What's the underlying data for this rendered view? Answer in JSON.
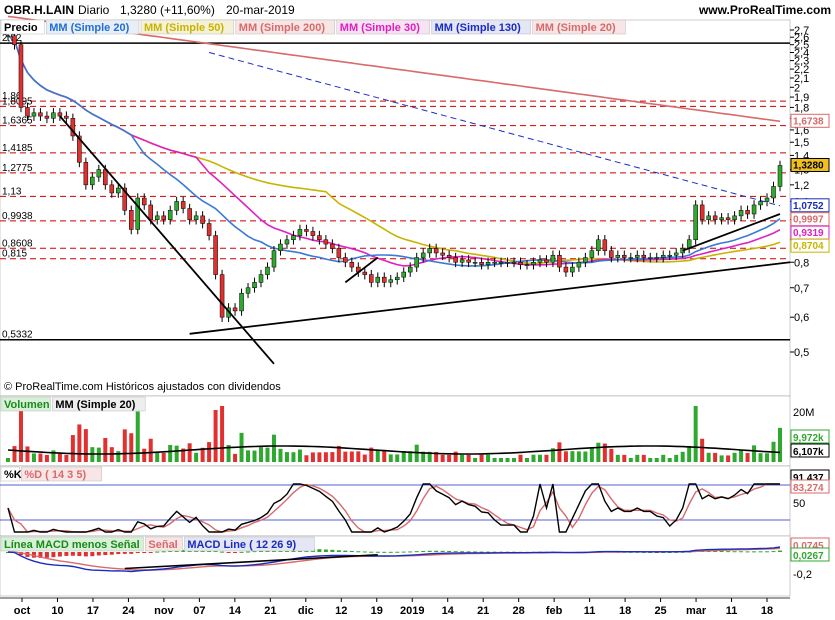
{
  "header": {
    "symbol": "OBR.H.LAIN",
    "period": "Diario",
    "last": "1,3280 (+11,60%)",
    "date": "20-mar-2019",
    "site": "www.ProRealTime.com"
  },
  "legends": {
    "price": [
      {
        "text": "Precio",
        "color": "#000000",
        "bg": "#ffffff"
      },
      {
        "text": "MM (Simple 20)",
        "color": "#1f6fd6",
        "bg": "#e8eef8"
      },
      {
        "text": "MM (Simple 50)",
        "color": "#c8b400",
        "bg": "#f5f1d8"
      },
      {
        "text": "MM (Simple 200)",
        "color": "#d86a6a",
        "bg": "#f8e6e6"
      },
      {
        "text": "MM (Simple 30)",
        "color": "#e020c0",
        "bg": "#f7e4f3"
      },
      {
        "text": "MM (Simple 130)",
        "color": "#1a2cc0",
        "bg": "#e4e6f6"
      },
      {
        "text": "MM (Simple 20)",
        "color": "#d86a6a",
        "bg": "#f8e6e6"
      }
    ],
    "volume": [
      {
        "text": "Volumen",
        "color": "#1a8a1a",
        "bg": "#d8f0d8"
      },
      {
        "text": "MM (Simple 20)",
        "color": "#000000",
        "bg": "#eeeeee"
      }
    ],
    "stoch": [
      {
        "text": "%K",
        "color": "#000000",
        "bg": "#ffffff"
      },
      {
        "text": "%D ( 14 3 5)",
        "color": "#d86a6a",
        "bg": "#f8e6e6"
      }
    ],
    "macd": [
      {
        "text": "Línea MACD menos Señal",
        "color": "#1a8a1a",
        "bg": "#d8f0d8"
      },
      {
        "text": "Señal",
        "color": "#d86a6a",
        "bg": "#f8e6e6"
      },
      {
        "text": "MACD Line ( 12 26 9)",
        "color": "#1a2cc0",
        "bg": "#e4e6f6"
      }
    ]
  },
  "footer_note": "© ProRealTime.com Históricos ajustados con dividendos",
  "price_axis_ticks": [
    "2,7",
    "2,6",
    "2,5",
    "2,4",
    "2,3",
    "2,2",
    "2,1",
    "2",
    "1,9",
    "1,8",
    "1,7",
    "1,6",
    "1,5",
    "1,4",
    "1,3",
    "1,2",
    "1,1",
    "1",
    "0,9",
    "0,8",
    "0,7",
    "0,6",
    "0,5"
  ],
  "hline_labels": [
    "2,52",
    "1,86",
    "1,8095",
    "1,6365",
    "1,4185",
    "1,2775",
    "1,13",
    "0,9938",
    "0,8608",
    "0,815",
    "0,5332"
  ],
  "price_tags": [
    {
      "text": "1,6738",
      "value": 1.6738,
      "color": "#d86a6a",
      "bg": "#ffffff"
    },
    {
      "text": "1,3280",
      "value": 1.328,
      "color": "#000000",
      "bg": "#f0c020"
    },
    {
      "text": "1,0752",
      "value": 1.0752,
      "color": "#1a2cc0",
      "bg": "#ffffff"
    },
    {
      "text": "0,9997",
      "value": 0.9997,
      "color": "#d86a6a",
      "bg": "#ffffff"
    },
    {
      "text": "0,9319",
      "value": 0.9319,
      "color": "#e020c0",
      "bg": "#ffffff"
    },
    {
      "text": "0,8704",
      "value": 0.8704,
      "color": "#c8b400",
      "bg": "#ffffff"
    }
  ],
  "volume_axis": {
    "top": "20M",
    "val1": "9,972k",
    "val2": "6,107k"
  },
  "stoch_axis": {
    "tick": "50",
    "val1": "91,437",
    "val2": "83,274"
  },
  "macd_axis": {
    "tick1": "0",
    "tick2": "-0,2",
    "val1": "0,0745",
    "val2": "0,0267"
  },
  "date_labels": [
    "oct",
    "10",
    "17",
    "24",
    "nov",
    "07",
    "14",
    "21",
    "dic",
    "12",
    "19",
    "2019",
    "14",
    "21",
    "28",
    "feb",
    "11",
    "18",
    "25",
    "mar",
    "11",
    "18"
  ],
  "colors": {
    "up": "#2fa82f",
    "down": "#e03030",
    "ma20": "#3a7ad6",
    "ma50": "#c8b400",
    "ma200": "#d86a6a",
    "ma30": "#e020c0",
    "ma130": "#1a2cc0",
    "hline": "#cc0000"
  },
  "chart_data": {
    "type": "candlestick",
    "title": "OBR.H.LAIN Diario",
    "ylim": [
      0.5,
      2.7
    ],
    "log_scale": true,
    "horizontal_levels": [
      2.52,
      1.86,
      1.8095,
      1.6365,
      1.4185,
      1.2775,
      1.13,
      0.9938,
      0.8608,
      0.815,
      0.5332
    ],
    "close_series": [
      2.62,
      2.5,
      1.8,
      1.72,
      1.75,
      1.72,
      1.7,
      1.75,
      1.72,
      1.7,
      1.55,
      1.35,
      1.2,
      1.25,
      1.3,
      1.2,
      1.15,
      1.18,
      1.05,
      0.95,
      1.12,
      1.08,
      1.0,
      1.02,
      1.0,
      1.05,
      1.1,
      1.06,
      1.0,
      1.02,
      0.98,
      0.92,
      0.75,
      0.6,
      0.63,
      0.62,
      0.68,
      0.7,
      0.72,
      0.75,
      0.78,
      0.85,
      0.88,
      0.9,
      0.92,
      0.95,
      0.94,
      0.92,
      0.9,
      0.88,
      0.86,
      0.82,
      0.8,
      0.78,
      0.76,
      0.75,
      0.72,
      0.74,
      0.72,
      0.73,
      0.74,
      0.76,
      0.78,
      0.82,
      0.84,
      0.86,
      0.84,
      0.83,
      0.82,
      0.8,
      0.81,
      0.8,
      0.8,
      0.79,
      0.8,
      0.8,
      0.8,
      0.8,
      0.8,
      0.79,
      0.79,
      0.8,
      0.81,
      0.8,
      0.83,
      0.78,
      0.76,
      0.78,
      0.8,
      0.82,
      0.85,
      0.9,
      0.85,
      0.82,
      0.83,
      0.82,
      0.82,
      0.83,
      0.82,
      0.82,
      0.82,
      0.83,
      0.83,
      0.84,
      0.86,
      0.9,
      1.08,
      1.0,
      1.02,
      1.0,
      1.01,
      1.0,
      1.02,
      1.05,
      1.03,
      1.08,
      1.1,
      1.12,
      1.19,
      1.328
    ],
    "last_values": {
      "close": 1.328,
      "sma20": 1.0752,
      "sma30": 0.9319,
      "sma50": 0.8704,
      "sma200": 1.6738,
      "sma20_b": 0.9997
    },
    "volume_last": {
      "volume": 9972,
      "sma20": 6107
    },
    "stochastic_last": {
      "k": 91.437,
      "d": 83.274
    },
    "macd_last": {
      "histogram": 0.0267,
      "line": 0.0745
    }
  }
}
